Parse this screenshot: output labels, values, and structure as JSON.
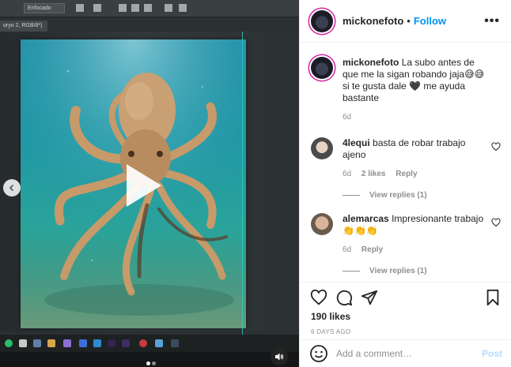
{
  "photoshop": {
    "mode_label": "Enfocado",
    "doc_tab": "oryo 2, RGB/8*) ×"
  },
  "header": {
    "username": "mickonefoto",
    "separator": "•",
    "follow": "Follow",
    "more": "•••"
  },
  "comments": [
    {
      "username": "mickonefoto",
      "text": "La subo antes de que me la sigan robando jaja😅😅 si te gusta dale 🖤 me ayuda bastante",
      "time": "6d",
      "likes": "",
      "reply": "",
      "view_replies": ""
    },
    {
      "username": "4lequi",
      "text": "basta de robar trabajo ajeno",
      "time": "6d",
      "likes": "2 likes",
      "reply": "Reply",
      "view_replies": "View replies (1)"
    },
    {
      "username": "alemarcas",
      "text": "Impresionante trabajo 👏👏👏",
      "time": "6d",
      "likes": "",
      "reply": "Reply",
      "view_replies": "View replies (1)"
    }
  ],
  "actions": {
    "likes": "190 likes",
    "date": "6 DAYS AGO"
  },
  "add_comment": {
    "placeholder": "Add a comment…",
    "post": "Post"
  },
  "colors": {
    "accent": "#0095f6",
    "muted": "#8e8e8e",
    "post_disabled": "#b3dbff",
    "guide": "#2ccfc0"
  }
}
